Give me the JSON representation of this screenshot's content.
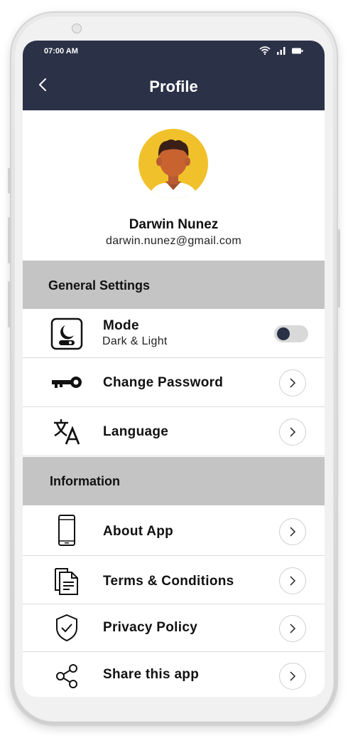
{
  "status_bar": {
    "time": "07:00 AM"
  },
  "header": {
    "title": "Profile"
  },
  "profile": {
    "name": "Darwin Nunez",
    "email": "darwin.nunez@gmail.com"
  },
  "general": {
    "title": "General Settings",
    "mode_label": "Mode",
    "mode_sub": "Dark & Light",
    "mode_toggle_on": false,
    "password_label": "Change Password",
    "language_label": "Language"
  },
  "information": {
    "title": "Information",
    "about_label": "About App",
    "terms_label": "Terms & Conditions",
    "privacy_label": "Privacy Policy",
    "share_label": "Share this app"
  },
  "colors": {
    "header_bg": "#2b3147",
    "section_bg": "#c4c4c4",
    "avatar_bg": "#f0c12a"
  }
}
